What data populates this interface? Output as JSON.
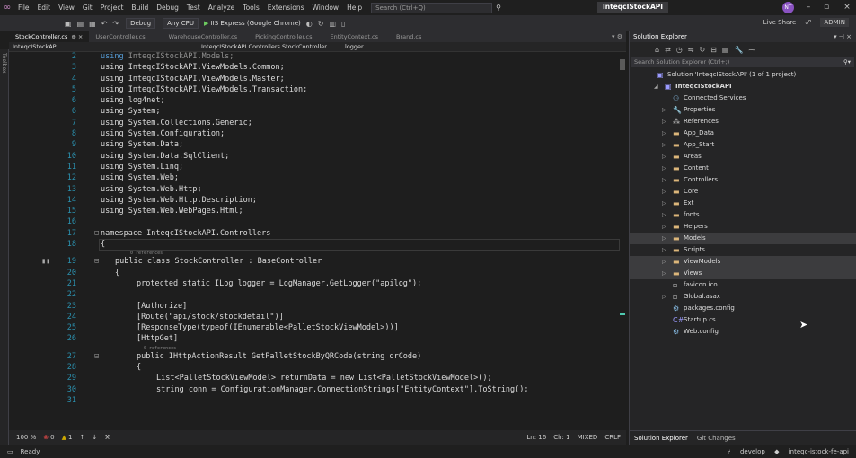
{
  "menu": [
    "File",
    "Edit",
    "View",
    "Git",
    "Project",
    "Build",
    "Debug",
    "Test",
    "Analyze",
    "Tools",
    "Extensions",
    "Window",
    "Help"
  ],
  "search_placeholder": "Search (Ctrl+Q)",
  "solution_title": "InteqcIStockAPI",
  "user_initials": "NT",
  "toolbar": {
    "config": "Debug",
    "platform": "Any CPU",
    "run_target": "IIS Express (Google Chrome)",
    "live_share": "Live Share",
    "admin": "ADMIN"
  },
  "tabs": [
    {
      "label": "StockController.cs",
      "active": true
    },
    {
      "label": "UserController.cs",
      "active": false
    },
    {
      "label": "WarehouseController.cs",
      "active": false
    },
    {
      "label": "PickingController.cs",
      "active": false
    },
    {
      "label": "EntityContext.cs",
      "active": false
    },
    {
      "label": "Brand.cs",
      "active": false
    }
  ],
  "nav": {
    "project": "InteqcIStockAPI",
    "class": "InteqcIStockAPI.Controllers.StockController",
    "member": "logger"
  },
  "code": {
    "l2": [
      "2",
      "using InteqcIStockAPI.Models;"
    ],
    "l3": [
      "3",
      "using InteqcIStockAPI.ViewModels.Common;"
    ],
    "l4": [
      "4",
      "using InteqcIStockAPI.ViewModels.Master;"
    ],
    "l5": [
      "5",
      "using InteqcIStockAPI.ViewModels.Transaction;"
    ],
    "l6": [
      "6",
      "using log4net;"
    ],
    "l7": [
      "6",
      "using System;"
    ],
    "l8": [
      "7",
      "using System.Collections.Generic;"
    ],
    "l9": [
      "8",
      "using System.Configuration;"
    ],
    "l10": [
      "9",
      "using System.Data;"
    ],
    "l11": [
      "10",
      "using System.Data.SqlClient;"
    ],
    "l12": [
      "11",
      "using System.Linq;"
    ],
    "l13": [
      "12",
      "using System.Web;"
    ],
    "l14": [
      "13",
      "using System.Web.Http;"
    ],
    "l15": [
      "14",
      "using System.Web.Http.Description;"
    ],
    "l16": [
      "15",
      "using System.Web.WebPages.Html;"
    ],
    "l17": [
      "16",
      ""
    ],
    "l18": [
      "17",
      "namespace InteqcIStockAPI.Controllers"
    ],
    "l19": [
      "18",
      "{"
    ],
    "lens1": "0 references",
    "l20": [
      "19",
      "public class StockController : BaseController"
    ],
    "l21": [
      "20",
      "{"
    ],
    "l22": [
      "21",
      "protected static ILog logger = LogManager.GetLogger(\"apilog\");"
    ],
    "l23": [
      "22",
      ""
    ],
    "l24": [
      "23",
      "[Authorize]"
    ],
    "l25": [
      "24",
      "[Route(\"api/stock/stockdetail\")]"
    ],
    "l26": [
      "25",
      "[ResponseType(typeof(IEnumerable<PalletStockViewModel>))]"
    ],
    "l27": [
      "26",
      "[HttpGet]"
    ],
    "lens2": "0 references",
    "l28": [
      "27",
      "public IHttpActionResult GetPalletStockByQRCode(string qrCode)"
    ],
    "l29": [
      "28",
      "{"
    ],
    "l30": [
      "29",
      "List<PalletStockViewModel> returnData = new List<PalletStockViewModel>();"
    ],
    "l31": [
      "30",
      "string conn = ConfigurationManager.ConnectionStrings[\"EntityContext\"].ToString();"
    ],
    "l32": [
      "31",
      ""
    ]
  },
  "status": {
    "zoom": "100 %",
    "errors": "0",
    "warnings": "1",
    "ln": "Ln: 16",
    "ch": "Ch: 1",
    "mode": "MIXED",
    "eol": "CRLF"
  },
  "solution_explorer": {
    "title": "Solution Explorer",
    "search_placeholder": "Search Solution Explorer (Ctrl+;)",
    "items": [
      {
        "label": "Solution 'InteqcIStockAPI' (1 of 1 project)",
        "indent": 0,
        "icon": "solution"
      },
      {
        "label": "InteqcIStockAPI",
        "indent": 1,
        "icon": "project"
      },
      {
        "label": "Connected Services",
        "indent": 2,
        "icon": "service"
      },
      {
        "label": "Properties",
        "indent": 2,
        "icon": "wrench"
      },
      {
        "label": "References",
        "indent": 2,
        "icon": "ref"
      },
      {
        "label": "App_Data",
        "indent": 2,
        "icon": "folder"
      },
      {
        "label": "App_Start",
        "indent": 2,
        "icon": "folder"
      },
      {
        "label": "Areas",
        "indent": 2,
        "icon": "folder"
      },
      {
        "label": "Content",
        "indent": 2,
        "icon": "folder"
      },
      {
        "label": "Controllers",
        "indent": 2,
        "icon": "folder"
      },
      {
        "label": "Core",
        "indent": 2,
        "icon": "folder"
      },
      {
        "label": "Ext",
        "indent": 2,
        "icon": "folder"
      },
      {
        "label": "fonts",
        "indent": 2,
        "icon": "folder"
      },
      {
        "label": "Helpers",
        "indent": 2,
        "icon": "folder"
      },
      {
        "label": "Models",
        "indent": 2,
        "icon": "folder",
        "selected": true
      },
      {
        "label": "Scripts",
        "indent": 2,
        "icon": "folder"
      },
      {
        "label": "ViewModels",
        "indent": 2,
        "icon": "folder",
        "selected": true
      },
      {
        "label": "Views",
        "indent": 2,
        "icon": "folder",
        "selected": true
      },
      {
        "label": "favicon.ico",
        "indent": 2,
        "icon": "file"
      },
      {
        "label": "Global.asax",
        "indent": 2,
        "icon": "file"
      },
      {
        "label": "packages.config",
        "indent": 2,
        "icon": "cfg"
      },
      {
        "label": "Startup.cs",
        "indent": 2,
        "icon": "cs"
      },
      {
        "label": "Web.config",
        "indent": 2,
        "icon": "cfg"
      }
    ],
    "bottom_tabs": [
      "Solution Explorer",
      "Git Changes"
    ]
  },
  "bottom": {
    "ready": "Ready",
    "branch": "develop",
    "repo": "inteqc-istock-fe-api"
  }
}
